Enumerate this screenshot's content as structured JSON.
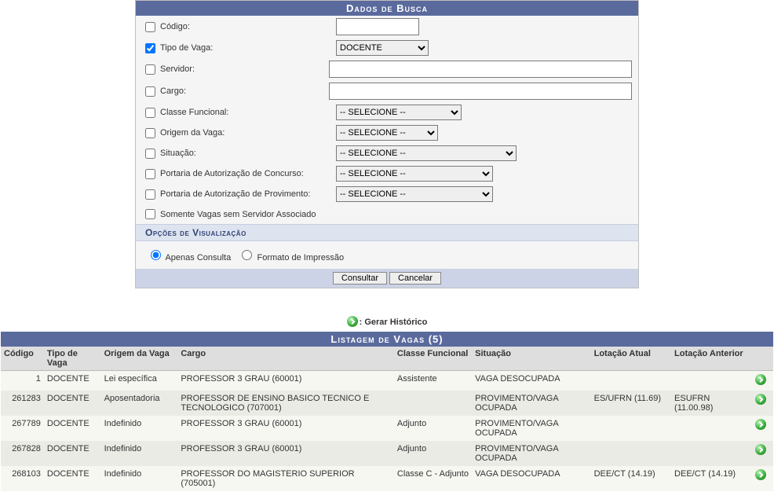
{
  "search": {
    "header": "Dados de Busca",
    "fields": {
      "codigo": "Código:",
      "tipoVaga": "Tipo de Vaga:",
      "tipoVagaSelected": "DOCENTE",
      "servidor": "Servidor:",
      "cargo": "Cargo:",
      "classeFuncional": "Classe Funcional:",
      "origemVaga": "Origem da Vaga:",
      "situacao": "Situação:",
      "portariaConcurso": "Portaria de Autorização de Concurso:",
      "portariaProvimento": "Portaria de Autorização de Provimento:",
      "somenteVagas": "Somente Vagas sem Servidor Associado",
      "selecioneOpt": "-- SELECIONE --"
    },
    "subHeader": "Opções de Visualização",
    "radio1": "Apenas Consulta",
    "radio2": "Formato de Impressão",
    "btnConsultar": "Consultar",
    "btnCancelar": "Cancelar"
  },
  "legend": {
    "label": ": Gerar Histórico"
  },
  "listagem": {
    "header": "Listagem de Vagas (5)",
    "cols": {
      "codigo": "Código",
      "tipoVaga": "Tipo de Vaga",
      "origem": "Origem da Vaga",
      "cargo": "Cargo",
      "classe": "Classe Funcional",
      "situacao": "Situação",
      "lotAtual": "Lotação Atual",
      "lotAnterior": "Lotação Anterior"
    },
    "rows": [
      {
        "codigo": "1",
        "tipoVaga": "DOCENTE",
        "origem": "Lei específica",
        "cargo": "PROFESSOR 3 GRAU (60001)",
        "classe": "Assistente",
        "situacao": "VAGA DESOCUPADA",
        "lotAtual": "",
        "lotAnterior": ""
      },
      {
        "codigo": "261283",
        "tipoVaga": "DOCENTE",
        "origem": "Aposentadoria",
        "cargo": "PROFESSOR DE ENSINO BASICO TECNICO E TECNOLOGICO (707001)",
        "classe": "",
        "situacao": "PROVIMENTO/VAGA OCUPADA",
        "lotAtual": "ES/UFRN (11.69)",
        "lotAnterior": "ESUFRN (11.00.98)"
      },
      {
        "codigo": "267789",
        "tipoVaga": "DOCENTE",
        "origem": "Indefinido",
        "cargo": "PROFESSOR 3 GRAU (60001)",
        "classe": "Adjunto",
        "situacao": "PROVIMENTO/VAGA OCUPADA",
        "lotAtual": "",
        "lotAnterior": ""
      },
      {
        "codigo": "267828",
        "tipoVaga": "DOCENTE",
        "origem": "Indefinido",
        "cargo": "PROFESSOR 3 GRAU (60001)",
        "classe": "Adjunto",
        "situacao": "PROVIMENTO/VAGA OCUPADA",
        "lotAtual": "",
        "lotAnterior": ""
      },
      {
        "codigo": "268103",
        "tipoVaga": "DOCENTE",
        "origem": "Indefinido",
        "cargo": "PROFESSOR DO MAGISTERIO SUPERIOR (705001)",
        "classe": "Classe C - Adjunto",
        "situacao": "VAGA DESOCUPADA",
        "lotAtual": "DEE/CT (14.19)",
        "lotAnterior": "DEE/CT (14.19)"
      }
    ]
  }
}
